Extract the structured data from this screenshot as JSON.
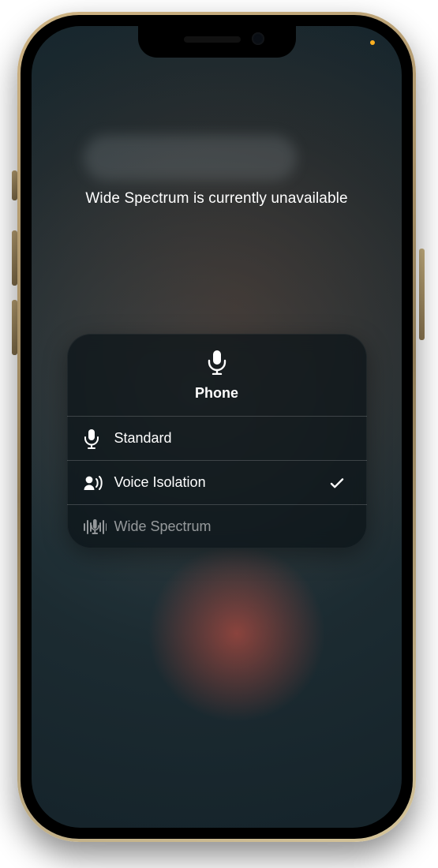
{
  "status_message": "Wide Spectrum is currently unavailable",
  "panel": {
    "header_title": "Phone",
    "options": [
      {
        "label": "Standard",
        "selected": false,
        "disabled": false
      },
      {
        "label": "Voice Isolation",
        "selected": true,
        "disabled": false
      },
      {
        "label": "Wide Spectrum",
        "selected": false,
        "disabled": true
      }
    ]
  }
}
